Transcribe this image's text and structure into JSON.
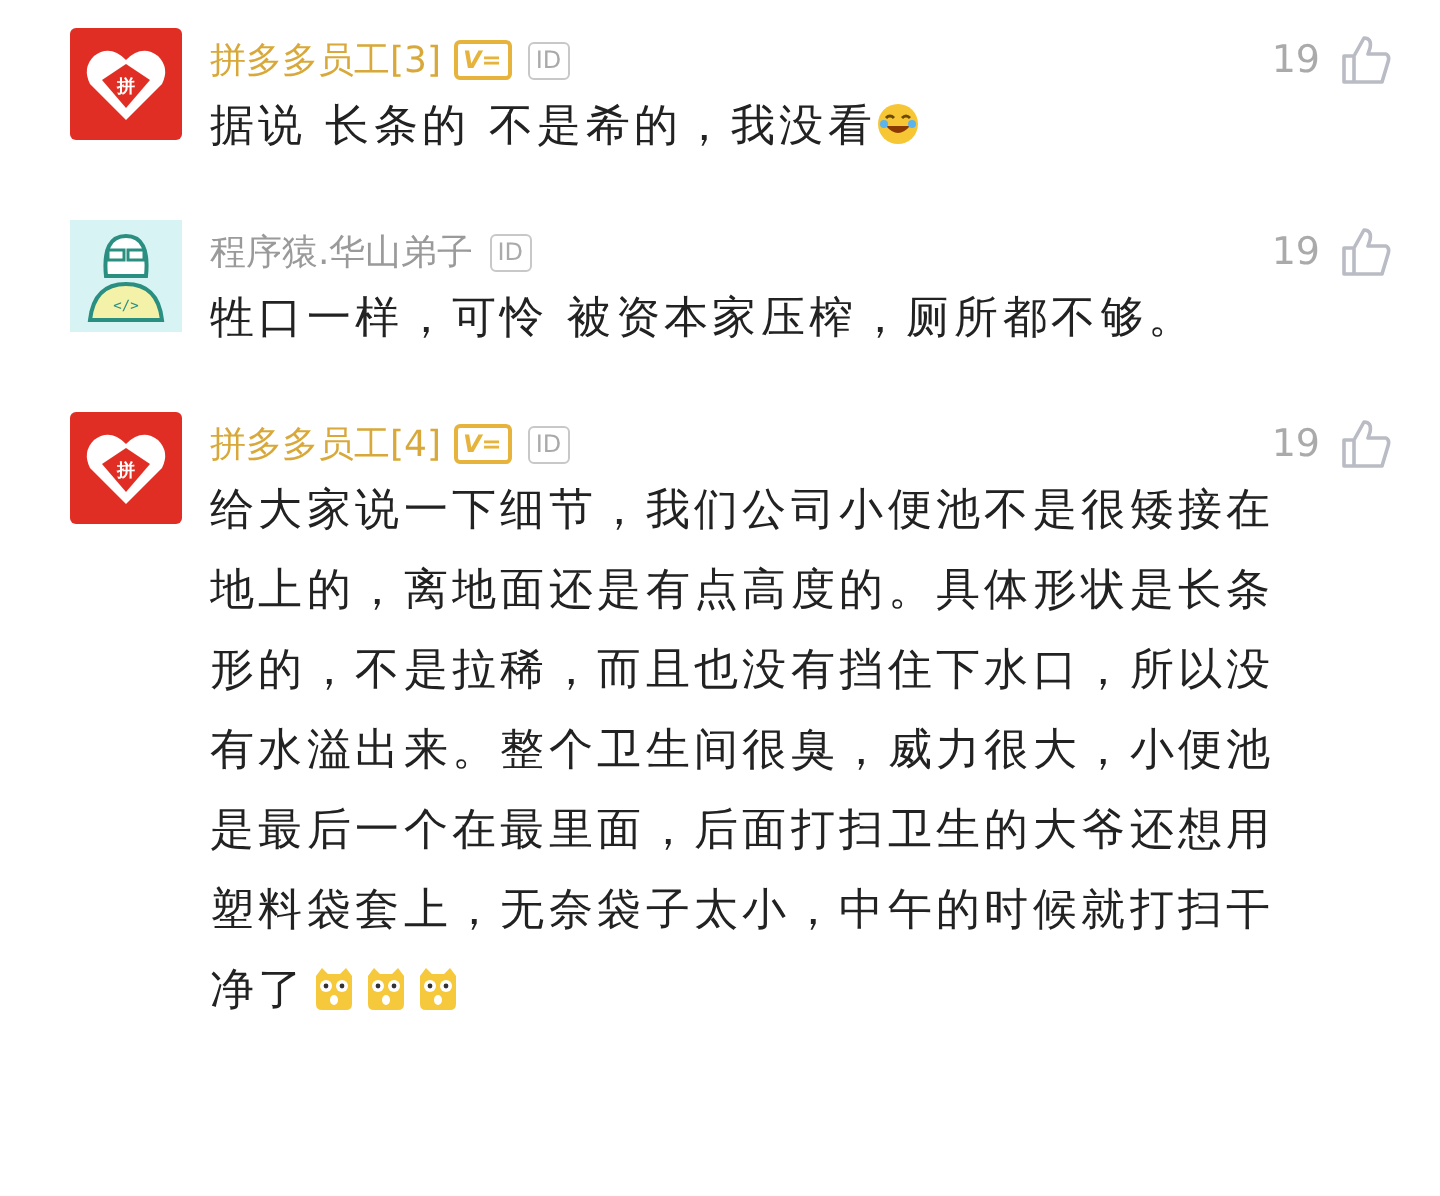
{
  "comments": [
    {
      "avatar": {
        "kind": "shop",
        "logo_text": "拼"
      },
      "name": "拼多多员工[3]",
      "kind": "vip",
      "vip_badge": "V=",
      "id_badge": "ID",
      "likes": "19",
      "text": "据说 长条的 不是希的，我没看",
      "emojis": [
        {
          "kind": "laugh"
        }
      ]
    },
    {
      "avatar": {
        "kind": "coder",
        "logo_text": "</>"
      },
      "name": "程序猿.华山弟子",
      "kind": "plain",
      "id_badge": "ID",
      "likes": "19",
      "text": "牲口一样，可怜 被资本家压榨，厕所都不够。"
    },
    {
      "avatar": {
        "kind": "shop",
        "logo_text": "拼"
      },
      "name": "拼多多员工[4]",
      "kind": "vip",
      "vip_badge": "V=",
      "id_badge": "ID",
      "likes": "19",
      "text": "给大家说一下细节，我们公司小便池不是很矮接在地上的，离地面还是有点高度的。具体形状是长条形的，不是拉稀，而且也没有挡住下水口，所以没有水溢出来。整个卫生间很臭，威力很大，小便池是最后一个在最里面，后面打扫卫生的大爷还想用塑料袋套上，无奈袋子太小，中午的时候就打扫干净了",
      "emojis": [
        {
          "kind": "shock"
        },
        {
          "kind": "shock"
        },
        {
          "kind": "shock"
        }
      ]
    }
  ]
}
